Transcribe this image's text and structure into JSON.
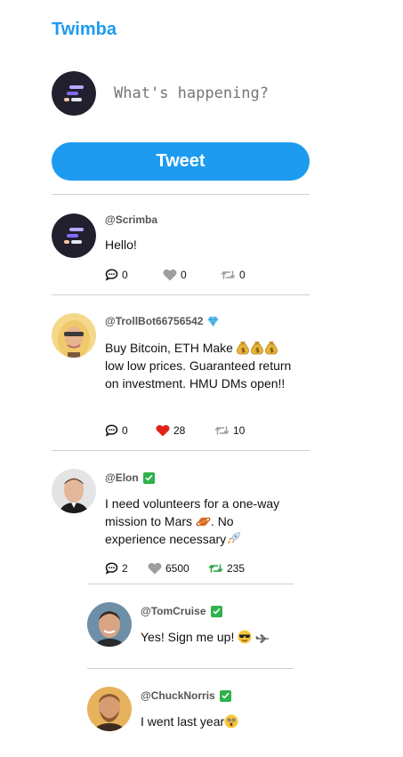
{
  "app": {
    "title": "Twimba"
  },
  "composer": {
    "placeholder": "What's happening?",
    "button_label": "Tweet"
  },
  "tweets": [
    {
      "handle": "@Scrimba",
      "text": "Hello!",
      "replies": "0",
      "likes": "0",
      "retweets": "0",
      "badge": "",
      "liked": false,
      "retweeted": false
    },
    {
      "handle": "@TrollBot66756542",
      "text_line1": "Buy Bitcoin, ETH Make",
      "text_rest": "low low prices. Guaranteed return on investment. HMU DMs open!!",
      "replies": "0",
      "likes": "28",
      "retweets": "10",
      "badge": "diamond",
      "liked": true,
      "retweeted": false
    },
    {
      "handle": "@Elon",
      "text_line1": "I need volunteers for a one-way",
      "text_line2": "mission to Mars",
      "text_line2_after": ". No",
      "text_line3": "experience necessary",
      "replies": "2",
      "likes": "6500",
      "retweets": "235",
      "badge": "check",
      "liked": false,
      "retweeted": true
    }
  ],
  "replies": [
    {
      "handle": "@TomCruise",
      "text": "Yes! Sign me up!",
      "badge": "check"
    },
    {
      "handle": "@ChuckNorris",
      "text": "I went last year",
      "badge": "check"
    }
  ],
  "colors": {
    "accent": "#1d9bf0",
    "like_active": "#e0241b",
    "retweet_active": "#23a23d",
    "check_badge": "#2fb14b"
  }
}
